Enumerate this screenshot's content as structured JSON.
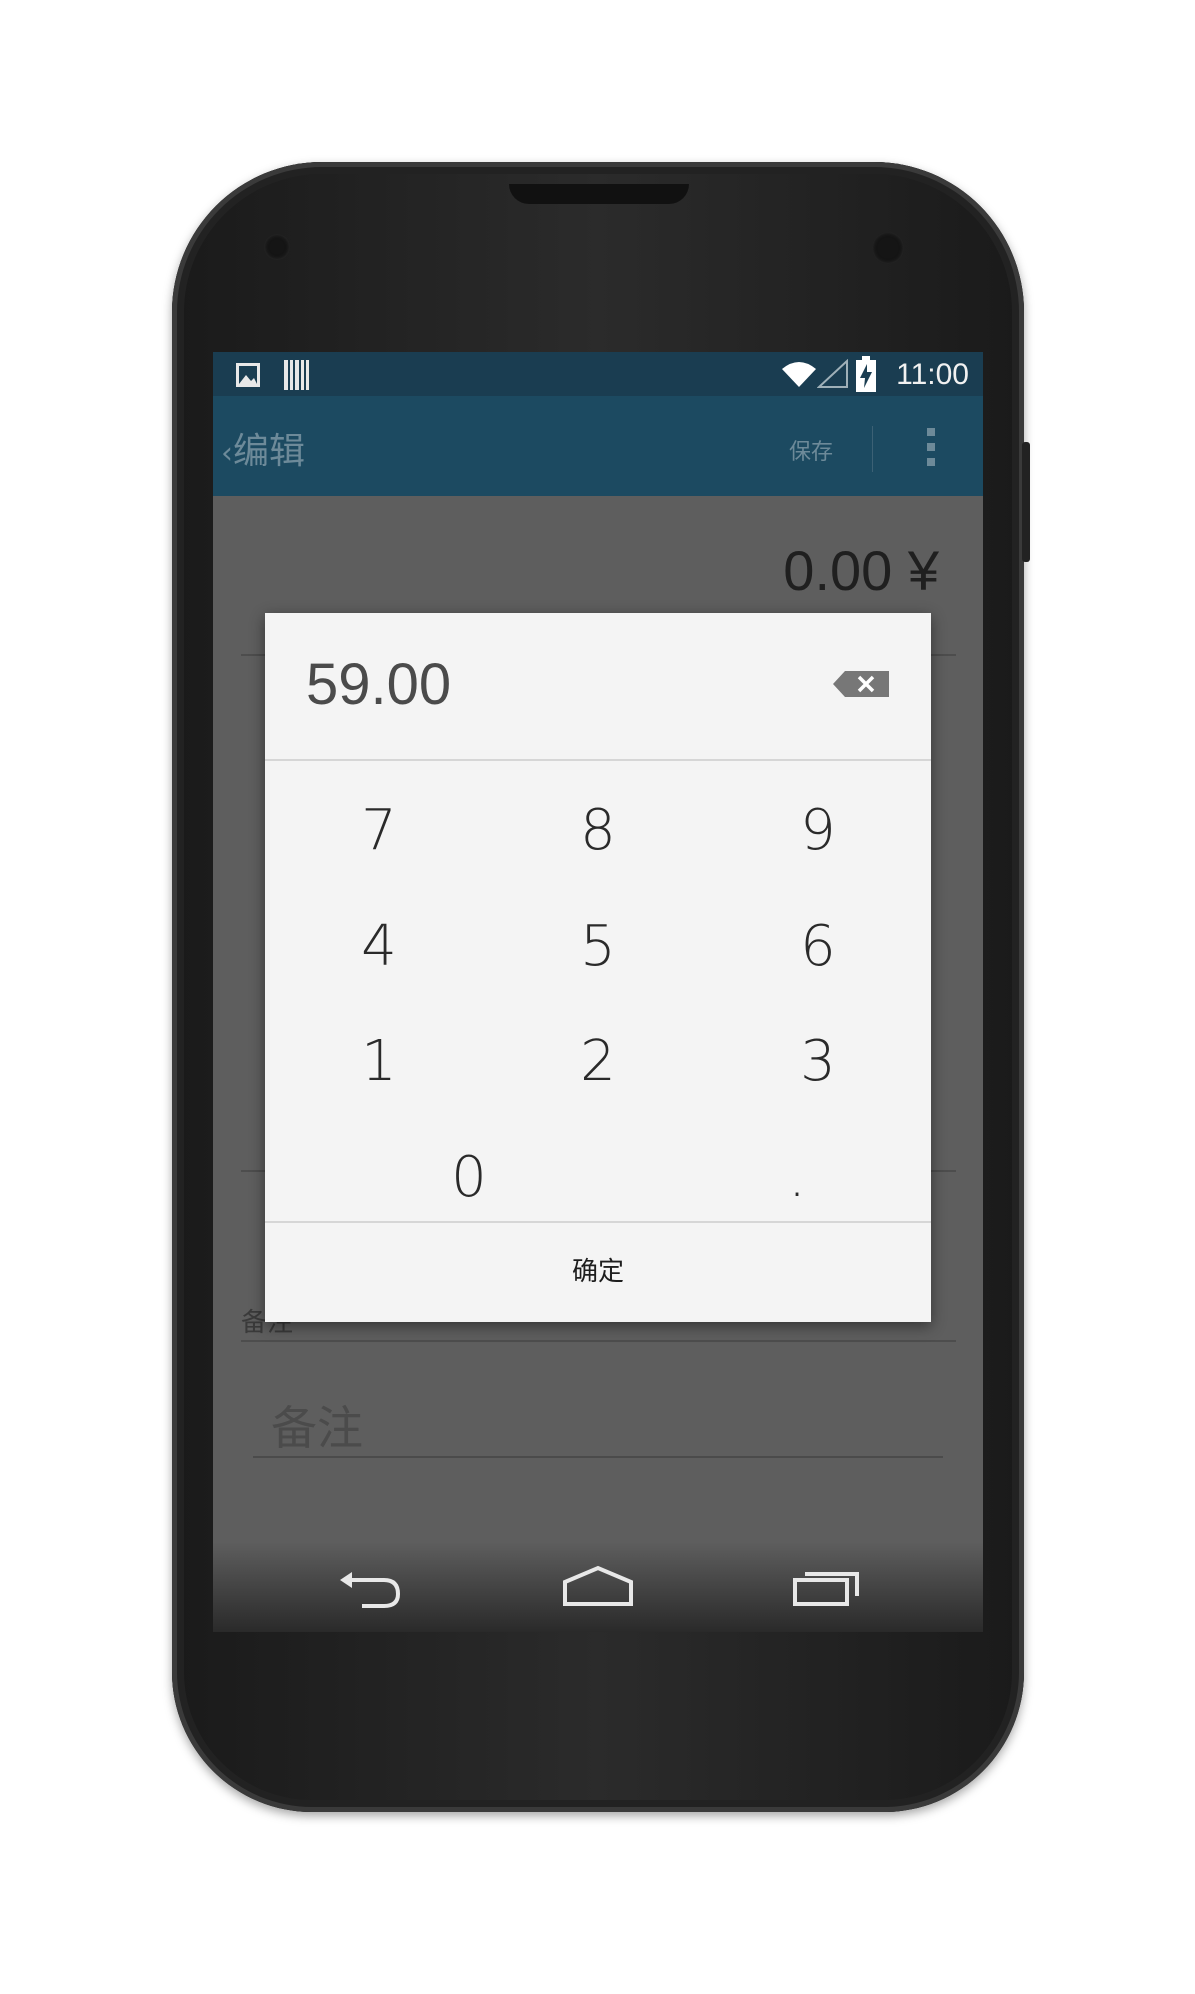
{
  "status_bar": {
    "time": "11:00",
    "icons": [
      "image-icon",
      "barcode-icon",
      "wifi-icon",
      "signal-icon",
      "battery-charging-icon"
    ]
  },
  "app_bar": {
    "back_label": "编辑",
    "save_label": "保存",
    "overflow_icon": "more-vert-icon",
    "color": "#1c4a61"
  },
  "background_form": {
    "amount": "0.00 ¥",
    "note_label": "备注",
    "note_placeholder": "备注"
  },
  "dialog": {
    "value": "59.00",
    "keys": [
      [
        "7",
        "8",
        "9"
      ],
      [
        "4",
        "5",
        "6"
      ],
      [
        "1",
        "2",
        "3"
      ],
      [
        "0",
        "."
      ]
    ],
    "confirm_label": "确定"
  },
  "nav_bar": {
    "icons": [
      "back-icon",
      "home-icon",
      "recents-icon"
    ]
  }
}
